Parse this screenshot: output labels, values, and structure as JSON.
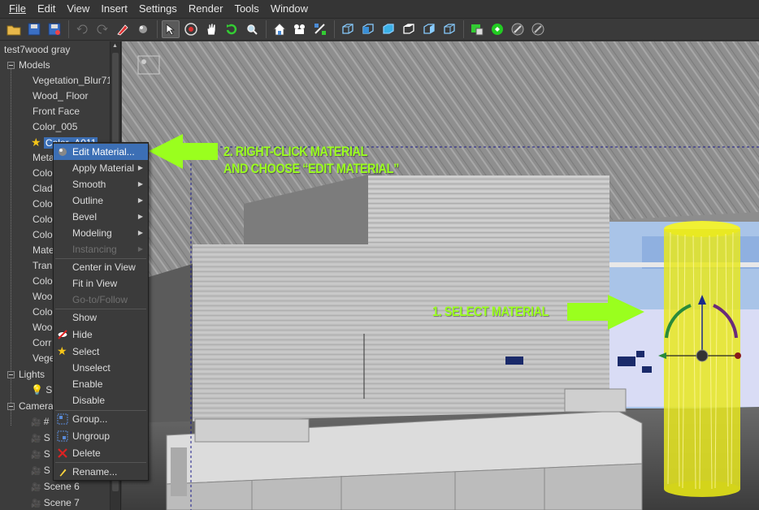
{
  "menubar": {
    "items": [
      "File",
      "Edit",
      "View",
      "Insert",
      "Settings",
      "Render",
      "Tools",
      "Window"
    ]
  },
  "toolbar": {
    "icons": [
      "open-icon",
      "save-icon",
      "save-as-icon",
      "undo-icon",
      "redo-icon",
      "paint-icon",
      "sphere-icon",
      "select-icon",
      "orbit-icon",
      "pan-icon",
      "rotate-icon",
      "zoom-icon",
      "home-icon",
      "camera-icon",
      "transform-icon",
      "view-cube-1-icon",
      "view-cube-2-icon",
      "view-cube-3-icon",
      "view-cube-4-icon",
      "view-cube-5-icon",
      "view-cube-6-icon",
      "render-icon",
      "settings-green-icon",
      "tool-icon",
      "disable-icon"
    ]
  },
  "tree": {
    "root": "test7wood gray",
    "models_label": "Models",
    "models": [
      "Vegetation_Blur71",
      "Wood_ Floor",
      "Front Face",
      "Color_005",
      "Color_A011",
      "Meta",
      "Colo",
      "Clad",
      "Colo",
      "Colo",
      "Colo",
      "Mate",
      "Tran",
      "Colo",
      "Woo",
      "Colo",
      "Woo",
      "Corr",
      "Vege"
    ],
    "lights_label": "Lights",
    "lights": [
      "S"
    ],
    "cameras_label": "Camera",
    "cameras": [
      "#",
      "S",
      "S",
      "S",
      "Scene 6",
      "Scene 7"
    ]
  },
  "context_menu": {
    "items": [
      {
        "label": "Edit Material...",
        "icon": "sphere-icon",
        "highlight": true
      },
      {
        "label": "Apply Material",
        "submenu": true
      },
      {
        "label": "Smooth",
        "submenu": true
      },
      {
        "label": "Outline",
        "submenu": true
      },
      {
        "label": "Bevel",
        "submenu": true
      },
      {
        "label": "Modeling",
        "submenu": true
      },
      {
        "label": "Instancing",
        "submenu": true,
        "disabled": true
      },
      {
        "label": "Center in View"
      },
      {
        "label": "Fit in View"
      },
      {
        "label": "Go-to/Follow",
        "disabled": true
      },
      {
        "label": "Show"
      },
      {
        "label": "Hide",
        "icon": "hide-icon"
      },
      {
        "label": "Select",
        "icon": "star-icon"
      },
      {
        "label": "Unselect"
      },
      {
        "label": "Enable"
      },
      {
        "label": "Disable"
      },
      {
        "label": "Group...",
        "icon": "group-icon"
      },
      {
        "label": "Ungroup",
        "icon": "ungroup-icon"
      },
      {
        "label": "Delete",
        "icon": "delete-icon"
      },
      {
        "label": "Rename...",
        "icon": "rename-icon"
      }
    ]
  },
  "annotations": {
    "step2_line1": "2. RIGHT-CLICK MATERIAL",
    "step2_line2": "AND CHOOSE “EDIT MATERIAL”",
    "step1": "1. SELECT MATERIAL",
    "color": "#9aff1e"
  }
}
